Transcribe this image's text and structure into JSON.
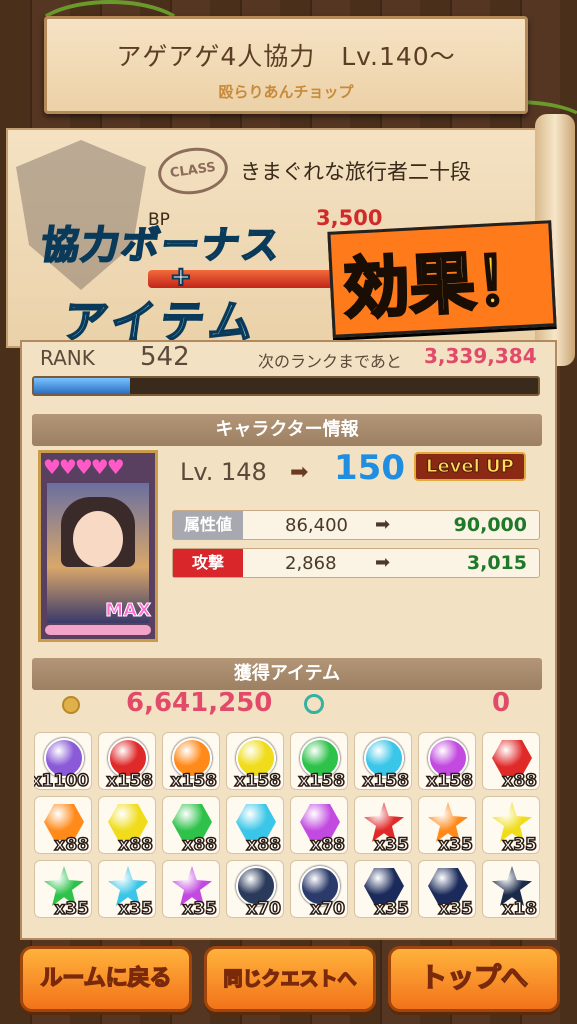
{
  "header": {
    "quest_title": "アゲアゲ4人協力　Lv.140〜",
    "boss_name": "殴らりあんチョップ"
  },
  "class_panel": {
    "badge_text": "CLASS",
    "class_name": "きまぐれな旅行者二十段",
    "bp_label": "BP",
    "bp_value": "3,500"
  },
  "promo": {
    "line1": "協力ボーナス",
    "plus": "+",
    "line2": "アイテム",
    "line3": "効果！"
  },
  "rank": {
    "label": "RANK",
    "value": "542",
    "next_label": "次のランクまであと",
    "next_value": "3,339,384",
    "progress_fraction": 0.19
  },
  "character": {
    "section_title": "キャラクター情報",
    "hearts": "♥♥♥♥♥",
    "max_label": "MAX",
    "level_label": "Lv. 148",
    "level_new": "150",
    "levelup_label": "Level UP",
    "stats": [
      {
        "label": "属性値",
        "old": "86,400",
        "new": "90,000",
        "color": "#a8a8b0"
      },
      {
        "label": "攻撃",
        "old": "2,868",
        "new": "3,015",
        "color": "#d8262a"
      }
    ]
  },
  "items": {
    "section_title": "獲得アイテム",
    "coins": "6,641,250",
    "water": "0",
    "list": [
      {
        "shape": "round",
        "color": "#8a5ad8",
        "qty": "x1100"
      },
      {
        "shape": "round",
        "color": "#e02a2a",
        "qty": "x158"
      },
      {
        "shape": "round",
        "color": "#ff8a1a",
        "qty": "x158"
      },
      {
        "shape": "round",
        "color": "#f0dc1a",
        "qty": "x158"
      },
      {
        "shape": "round",
        "color": "#2ec24a",
        "qty": "x158"
      },
      {
        "shape": "round",
        "color": "#3ac6e8",
        "qty": "x158"
      },
      {
        "shape": "round",
        "color": "#c24ae0",
        "qty": "x158"
      },
      {
        "shape": "hex",
        "color": "#e02a2a",
        "qty": "x88"
      },
      {
        "shape": "hex",
        "color": "#ff8a1a",
        "qty": "x88"
      },
      {
        "shape": "hex",
        "color": "#f0dc1a",
        "qty": "x88"
      },
      {
        "shape": "hex",
        "color": "#2ec24a",
        "qty": "x88"
      },
      {
        "shape": "hex",
        "color": "#3ac6e8",
        "qty": "x88"
      },
      {
        "shape": "hex",
        "color": "#c24ae0",
        "qty": "x88"
      },
      {
        "shape": "star",
        "color": "#e02a2a",
        "qty": "x35"
      },
      {
        "shape": "star",
        "color": "#ff8a1a",
        "qty": "x35"
      },
      {
        "shape": "star",
        "color": "#f0dc1a",
        "qty": "x35"
      },
      {
        "shape": "star",
        "color": "#2ec24a",
        "qty": "x35"
      },
      {
        "shape": "star",
        "color": "#3ac6e8",
        "qty": "x35"
      },
      {
        "shape": "star",
        "color": "#c24ae0",
        "qty": "x35"
      },
      {
        "shape": "round",
        "color": "#2a3a5a",
        "qty": "x70"
      },
      {
        "shape": "round",
        "color": "#2a3a6a",
        "qty": "x70"
      },
      {
        "shape": "hex",
        "color": "#1a2a5a",
        "qty": "x35"
      },
      {
        "shape": "hex",
        "color": "#1a2a5a",
        "qty": "x35"
      },
      {
        "shape": "star",
        "color": "#1a2a4a",
        "qty": "x18"
      }
    ]
  },
  "buttons": {
    "back_room": "ルームに戻る",
    "same_quest": "同じクエストへ",
    "top": "トップへ"
  }
}
